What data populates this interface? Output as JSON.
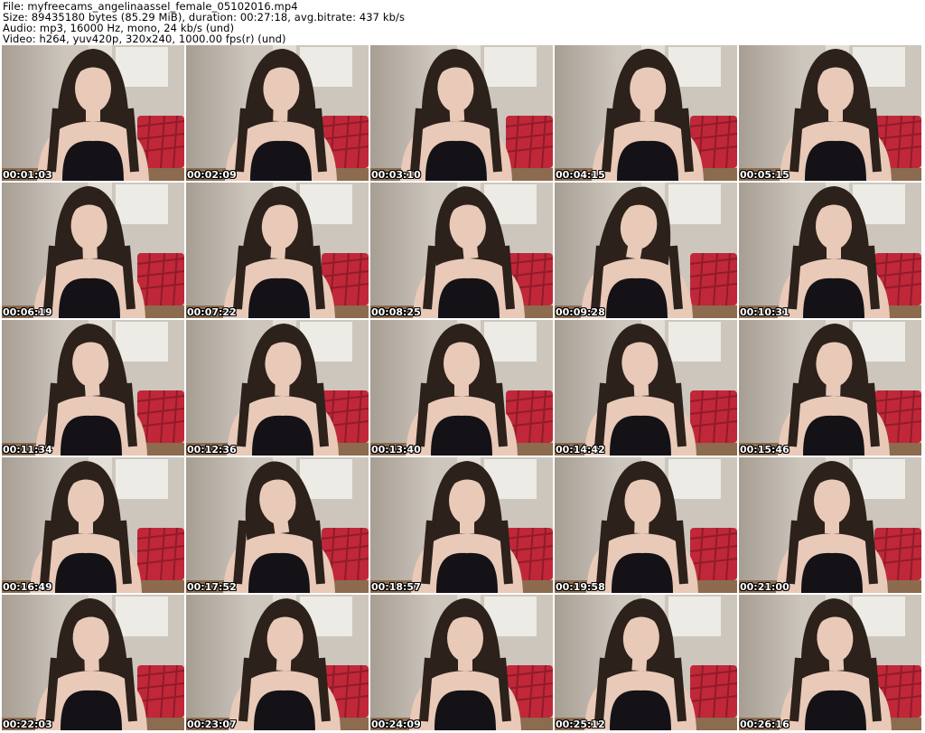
{
  "header": {
    "file": "File: myfreecams_angelinaassel_female_05102016.mp4",
    "size": "Size: 89435180 bytes (85.29 MiB), duration: 00:27:18, avg.bitrate: 437 kb/s",
    "audio": "Audio: mp3, 16000 Hz, mono, 24 kb/s (und)",
    "video": "Video: h264, yuv420p, 320x240, 1000.00 fps(r) (und)"
  },
  "thumbnails": [
    {
      "timestamp": "00:01:03"
    },
    {
      "timestamp": "00:02:09"
    },
    {
      "timestamp": "00:03:10"
    },
    {
      "timestamp": "00:04:15"
    },
    {
      "timestamp": "00:05:15"
    },
    {
      "timestamp": "00:06:19"
    },
    {
      "timestamp": "00:07:22"
    },
    {
      "timestamp": "00:08:25"
    },
    {
      "timestamp": "00:09:28"
    },
    {
      "timestamp": "00:10:31"
    },
    {
      "timestamp": "00:11:34"
    },
    {
      "timestamp": "00:12:36"
    },
    {
      "timestamp": "00:13:40"
    },
    {
      "timestamp": "00:14:42"
    },
    {
      "timestamp": "00:15:46"
    },
    {
      "timestamp": "00:16:49"
    },
    {
      "timestamp": "00:17:52"
    },
    {
      "timestamp": "00:18:57"
    },
    {
      "timestamp": "00:19:58"
    },
    {
      "timestamp": "00:21:00"
    },
    {
      "timestamp": "00:22:03"
    },
    {
      "timestamp": "00:23:07"
    },
    {
      "timestamp": "00:24:09"
    },
    {
      "timestamp": "00:25:12"
    },
    {
      "timestamp": "00:26:16"
    }
  ],
  "colors": {
    "wall": "#cdc6bd",
    "wall_shadow": "#a79e93",
    "poster": "#ecebe6",
    "chair": "#c0283a",
    "chair_dark": "#7d1522",
    "hair": "#2c211b",
    "skin": "#e9c9b8",
    "top": "#141216",
    "timestamp_text": "#ffffff"
  }
}
